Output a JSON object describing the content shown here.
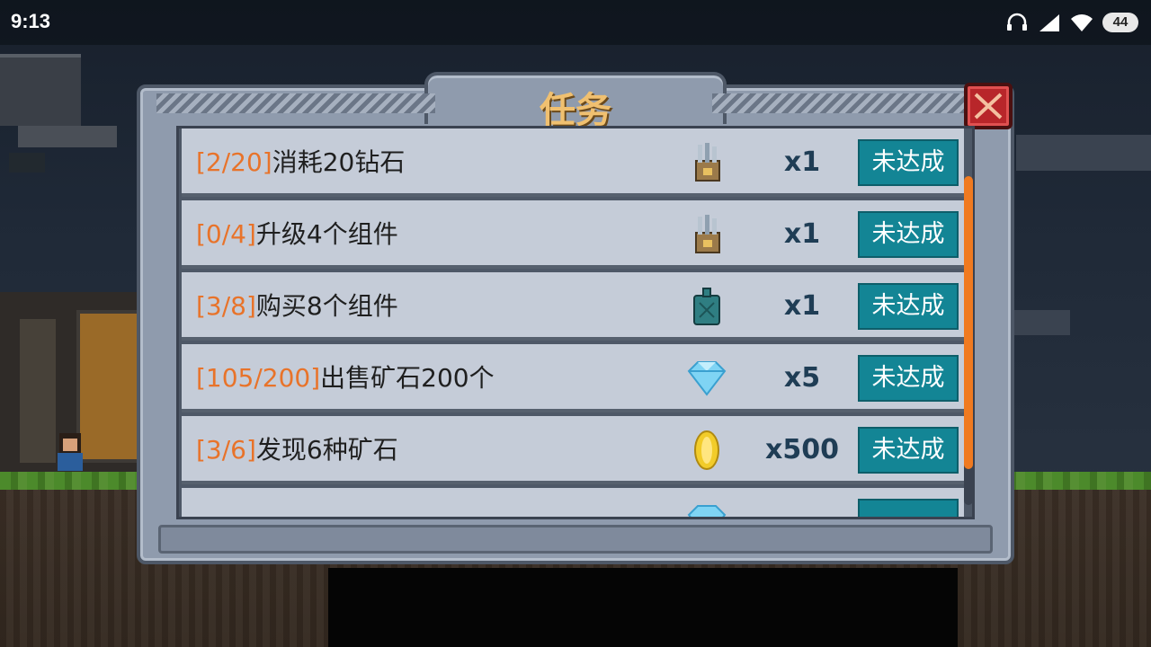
{
  "status_bar": {
    "time": "9:13",
    "battery": "44",
    "icons": [
      "headphones-icon",
      "signal-icon",
      "wifi-icon",
      "battery-icon"
    ]
  },
  "dialog": {
    "title": "任务",
    "close_icon": "close-icon"
  },
  "tasks": [
    {
      "progress": "[2/20]",
      "description": "消耗20钻石",
      "reward_icon": "toolbag-icon",
      "reward_qty": "x1",
      "status": "未达成"
    },
    {
      "progress": "[0/4]",
      "description": "升级4个组件",
      "reward_icon": "toolbag-icon",
      "reward_qty": "x1",
      "status": "未达成"
    },
    {
      "progress": "[3/8]",
      "description": "购买8个组件",
      "reward_icon": "fuel-can-icon",
      "reward_qty": "x1",
      "status": "未达成"
    },
    {
      "progress": "[105/200]",
      "description": "出售矿石200个",
      "reward_icon": "diamond-icon",
      "reward_qty": "x5",
      "status": "未达成"
    },
    {
      "progress": "[3/6]",
      "description": "发现6种矿石",
      "reward_icon": "gold-coin-icon",
      "reward_qty": "x500",
      "status": "未达成"
    }
  ],
  "colors": {
    "progress_text": "#e8732a",
    "status_button": "#138595",
    "title_text": "#f0c070",
    "scroll_thumb": "#f07a20",
    "close_button": "#b8262a"
  }
}
